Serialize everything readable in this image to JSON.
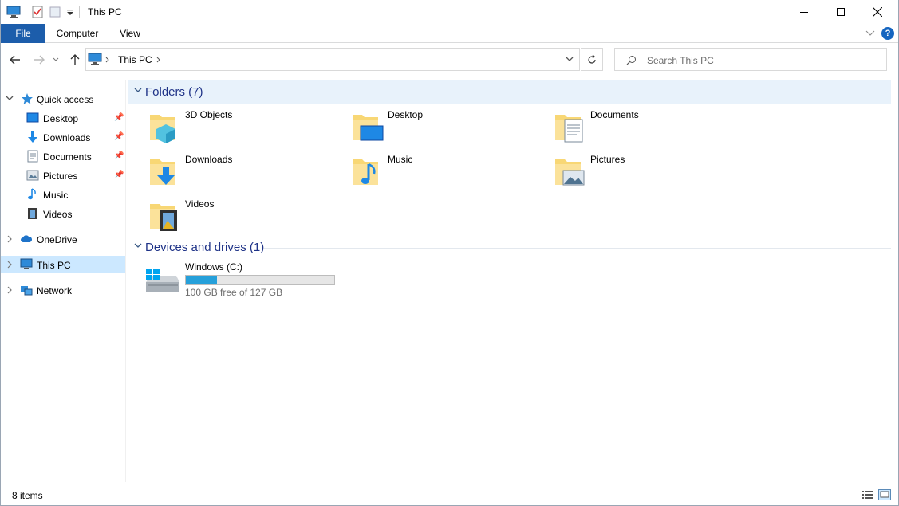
{
  "window": {
    "title": "This PC"
  },
  "ribbon": {
    "tabs": [
      "File",
      "Computer",
      "View"
    ]
  },
  "address": {
    "path_label": "This PC"
  },
  "search": {
    "placeholder": "Search This PC"
  },
  "sidebar": {
    "quick_access": "Quick access",
    "items": [
      "Desktop",
      "Downloads",
      "Documents",
      "Pictures",
      "Music",
      "Videos"
    ],
    "onedrive": "OneDrive",
    "this_pc": "This PC",
    "network": "Network"
  },
  "content": {
    "folders_header": "Folders (7)",
    "folders": [
      "3D Objects",
      "Desktop",
      "Documents",
      "Downloads",
      "Music",
      "Pictures",
      "Videos"
    ],
    "drives_header": "Devices and drives (1)",
    "drive": {
      "name": "Windows (C:)",
      "free_text": "100 GB free of 127 GB",
      "used_fraction": 0.21
    }
  },
  "status": {
    "item_count": "8 items"
  },
  "colors": {
    "accent": "#1c5dab",
    "selection": "#cce8ff",
    "folder": "#f8d775",
    "drive_bar": "#26a0da",
    "header_text": "#1e3287"
  }
}
